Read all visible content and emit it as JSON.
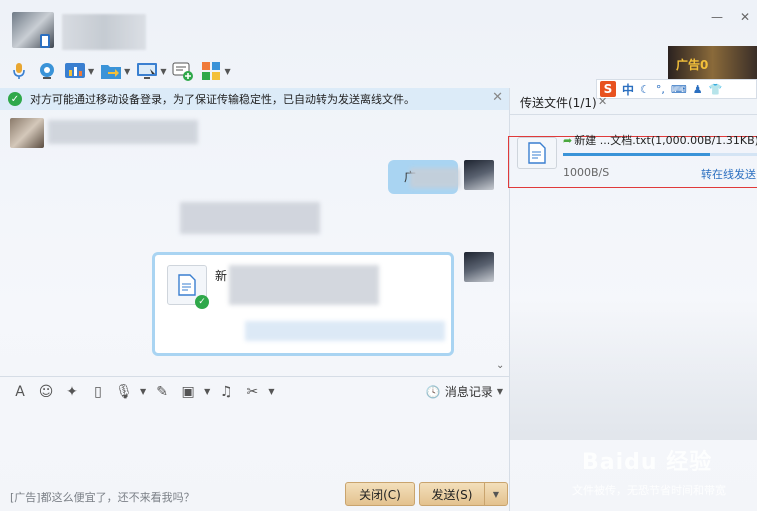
{
  "window": {
    "controls": {
      "minimize": "—",
      "close": "✕"
    }
  },
  "toolbar": {
    "items": [
      {
        "name": "voice-call",
        "icon": "microphone-icon"
      },
      {
        "name": "video-call",
        "icon": "camera-icon"
      },
      {
        "name": "app-center",
        "icon": "chart-icon"
      },
      {
        "name": "send-file",
        "icon": "folder-arrow-icon"
      },
      {
        "name": "remote-desktop",
        "icon": "monitor-icon"
      },
      {
        "name": "create-discussion",
        "icon": "chat-add-icon"
      },
      {
        "name": "apps",
        "icon": "grid-icon"
      }
    ]
  },
  "notice": {
    "text": "对方可能通过移动设备登录，为了保证传输稳定性，已自动转为发送离线文件。",
    "close": "✕"
  },
  "chat": {
    "out_bubble_text": "广",
    "file_card_name": "新"
  },
  "input_toolbar": {
    "history_label": "消息记录"
  },
  "footer": {
    "ad_text": "[广告]都这么便宜了，还不来看我吗？",
    "close_label": "关闭(C)",
    "send_label": "发送(S)"
  },
  "transfer_panel": {
    "tab_label": "传送文件(1/1)",
    "tab_close": "✕",
    "file_name": "新建 ...文档.txt(1,000.00B/1.31KB)",
    "progress": 0.75,
    "speed": "1000B/S",
    "action_link": "转在线发送"
  },
  "ime": {
    "logo": "S",
    "mode": "中",
    "punct": "°,"
  },
  "promo": {
    "text": "广告0"
  },
  "watermark": {
    "brand": "Baidu 经验",
    "sub": "文件被传，无恐节省时间和带宽"
  },
  "colors": {
    "accent": "#2b6fc0",
    "notice_bg": "#dcebf8",
    "bubble": "#a9d4f2",
    "success": "#2fa84a",
    "highlight_border": "#e03a3a"
  }
}
